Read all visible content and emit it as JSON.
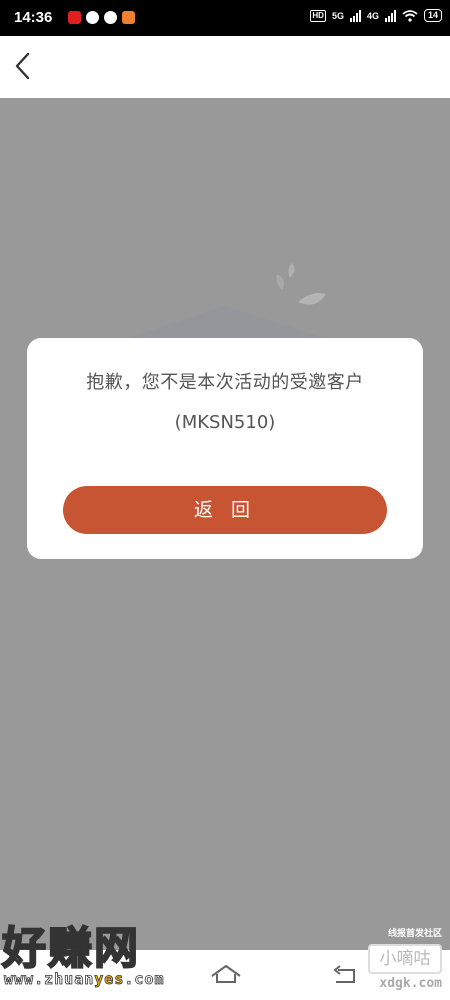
{
  "status_bar": {
    "time": "14:36",
    "network_hd": "HD",
    "network_5g": "5G",
    "network_4g": "4G",
    "battery": "14"
  },
  "dialog": {
    "message": "抱歉，您不是本次活动的受邀客户",
    "code": "(MKSN510)",
    "return_label": "返 回"
  },
  "watermark": {
    "brand": "好赚网",
    "url_prefix": "www.zhuan",
    "url_highlight": "yes",
    "url_suffix": ".com",
    "forum_tag": "线报首发社区",
    "forum_name": "小嘀咕",
    "forum_url": "xdgk.com"
  },
  "colors": {
    "accent": "#c75432",
    "overlay": "#999999",
    "dialog_bg": "#ffffff"
  },
  "icons": {
    "back": "chevron-left-icon",
    "home": "home-icon",
    "nav_back": "return-icon"
  }
}
